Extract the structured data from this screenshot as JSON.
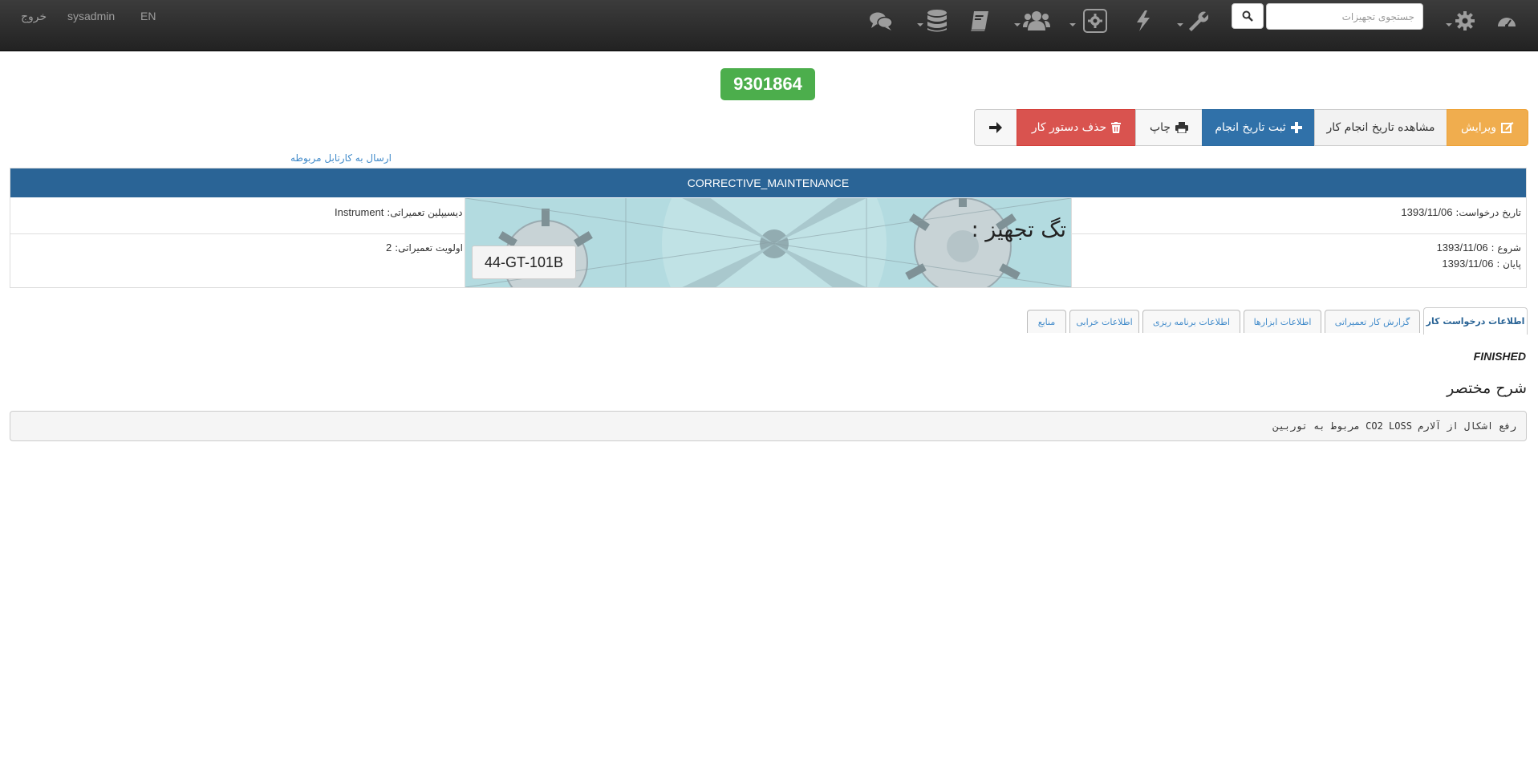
{
  "navbar": {
    "logout": "خروج",
    "username": "sysadmin",
    "language": "EN",
    "search_placeholder": "جستجوی تجهیزات",
    "icons": [
      "comments-icon",
      "database-icon",
      "book-icon",
      "users-icon",
      "settings-box-icon",
      "bolt-icon",
      "wrench-icon",
      "search-icon",
      "gear-icon",
      "dashboard-icon"
    ]
  },
  "order": {
    "number": "9301864"
  },
  "toolbar": {
    "edit": "ویرایش",
    "view_dates": "مشاهده تاریخ انجام کار",
    "register_date": "ثبت تاریخ انجام",
    "print": "چاپ",
    "delete": "حذف دستور کار"
  },
  "links": {
    "send_cartable": "ارسال به کارتابل مربوطه"
  },
  "info": {
    "header": "CORRECTIVE_MAINTENANCE",
    "request_date_label": "تاریخ درخواست:",
    "request_date": "1393/11/06",
    "start_label": "شروع :",
    "start": "1393/11/06",
    "end_label": "پایان :",
    "end": "1393/11/06",
    "discipline_label": "دیسیپلین تعمیراتی:",
    "discipline": "Instrument",
    "priority_label": "اولویت تعمیراتی:",
    "priority": "2",
    "equipment_tag_label": "تگ تجهیز :",
    "equipment_tag": "44-GT-101B"
  },
  "tabs": [
    "اطلاعات درخواست کار",
    "گزارش کار تعمیراتی",
    "اطلاعات ابزارها",
    "اطلاعات برنامه ریزی",
    "اطلاعات خرابی",
    "منابع"
  ],
  "status": "FINISHED",
  "summary": {
    "title": "شرح مختصر",
    "text": "رفع اشکال از آلارم CO2 LOSS مربوط به توربین"
  },
  "colors": {
    "navbar": "#222222",
    "badge": "#4cae4c",
    "edit": "#f0ad4e",
    "register": "#3071a9",
    "delete": "#d9534f",
    "header": "#2a6496"
  }
}
